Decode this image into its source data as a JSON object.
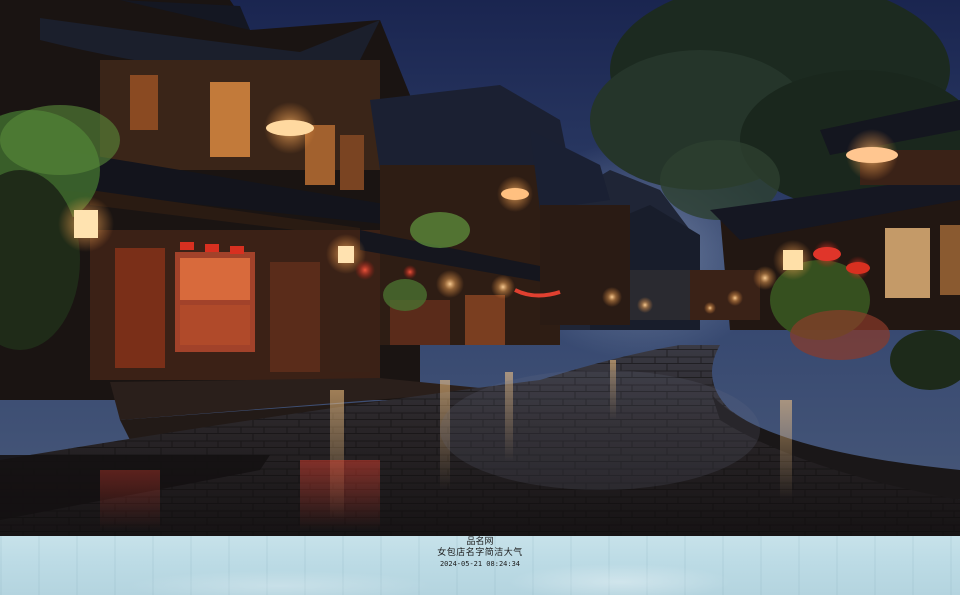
{
  "caption": {
    "site_name": "品名网",
    "title": "女包店名字简洁大气",
    "timestamp": "2024-05-21 08:24:34"
  },
  "scene": {
    "description_icon": "night-street-photo",
    "colors": {
      "sky": "#1e2b55",
      "lantern": "#ffb070",
      "red_lantern": "#e0352a",
      "caption_band": "#c0dde6"
    }
  }
}
